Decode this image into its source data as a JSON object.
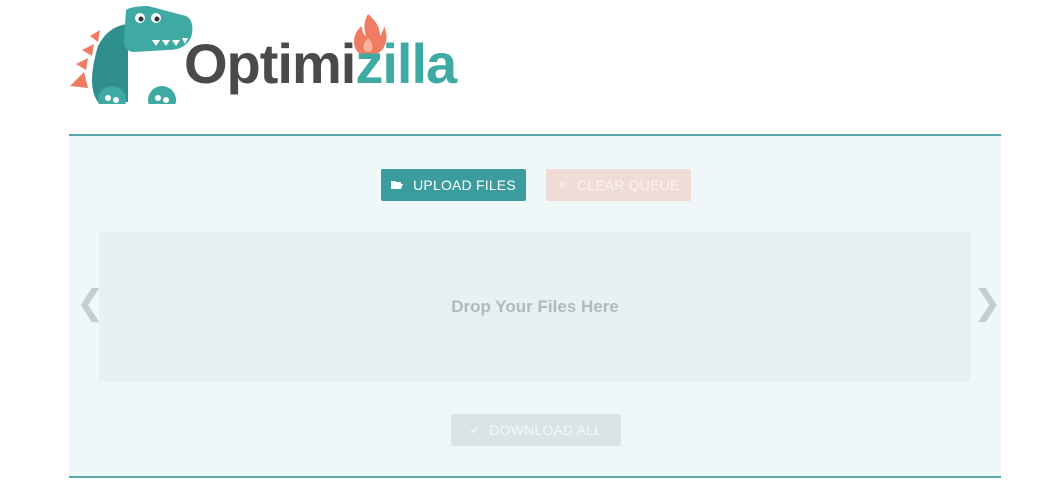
{
  "logo": {
    "text_a": "Optimi",
    "text_b": "zilla",
    "mascot": "dinosaur-mascot",
    "flame": "flame-icon",
    "colors": {
      "dark": "#4a4a4a",
      "teal": "#3fa9a4",
      "coral": "#f07c62"
    }
  },
  "toolbar": {
    "upload_label": "UPLOAD FILES",
    "upload_icon": "folder-open-icon",
    "clear_label": "CLEAR QUEUE",
    "clear_icon": "close-icon"
  },
  "dropzone": {
    "text": "Drop Your Files Here"
  },
  "carousel": {
    "prev_icon": "chevron-left-icon",
    "next_icon": "chevron-right-icon"
  },
  "footer": {
    "download_label": "DOWNLOAD ALL",
    "download_icon": "check-icon"
  },
  "colors": {
    "accent": "#3b9c9d",
    "border": "#5aa7a9",
    "panel_bg": "#f0f7f9",
    "clear_disabled": "#f0dcd6",
    "download_disabled": "#d9e4e5"
  }
}
